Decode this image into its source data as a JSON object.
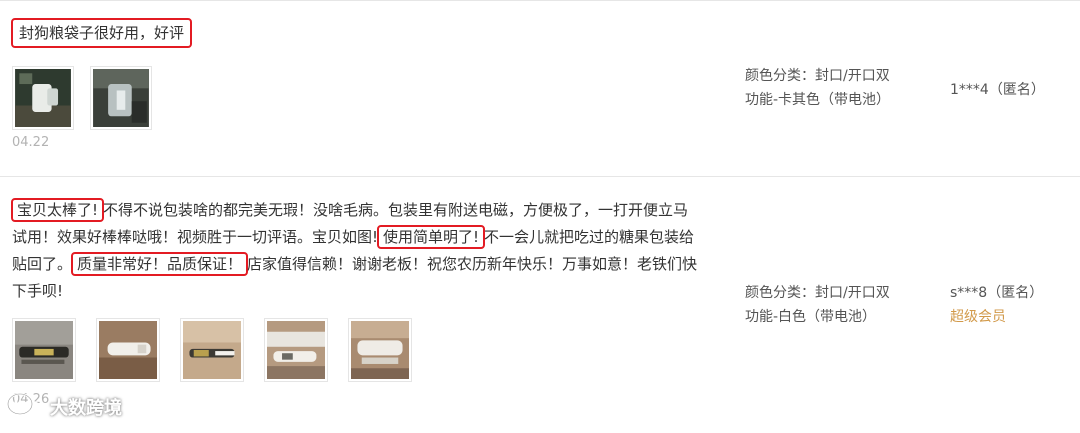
{
  "reviews": [
    {
      "content_parts": [
        "封狗粮袋子很好用，好评"
      ],
      "date": "04.22",
      "images": [
        {
          "icon": "product-photo-white-clip"
        },
        {
          "icon": "product-photo-gray-clip"
        }
      ],
      "sku": {
        "line1": "颜色分类：封口/开口双",
        "line2": "功能-卡其色（带电池）"
      },
      "user": {
        "name": "1***4（匿名）",
        "level": ""
      }
    },
    {
      "content_parts": [
        "宝贝太棒了!",
        "不得不说包装啥的都完美无瑕！没啥毛病。包装里有附送电磁，方便极了，一打开便立马试用！效果好棒棒哒哦！视频胜于一切评语。宝贝如图!",
        "使用简单明了!",
        "不一会儿就把吃过的糖果包装给贴回了。",
        "质量非常好！品质保证！",
        "店家值得信赖！谢谢老板！祝您农历新年快乐！万事如意！老铁们快下手呗!"
      ],
      "date": "04.26",
      "images": [
        {
          "icon": "product-photo-dark-clip"
        },
        {
          "icon": "product-photo-white-stick"
        },
        {
          "icon": "product-photo-sealer-hand"
        },
        {
          "icon": "product-photo-sealer-top"
        },
        {
          "icon": "product-photo-sealer-side"
        }
      ],
      "sku": {
        "line1": "颜色分类：封口/开口双",
        "line2": "功能-白色（带电池）"
      },
      "user": {
        "name": "s***8（匿名）",
        "level": "超级会员"
      }
    }
  ],
  "watermark": {
    "text": "大数跨境",
    "icon": "wechat-bubble-icon"
  },
  "colors": {
    "highlight_border": "#e31b23",
    "member": "#d29a4b",
    "date": "#b3b3b3"
  }
}
